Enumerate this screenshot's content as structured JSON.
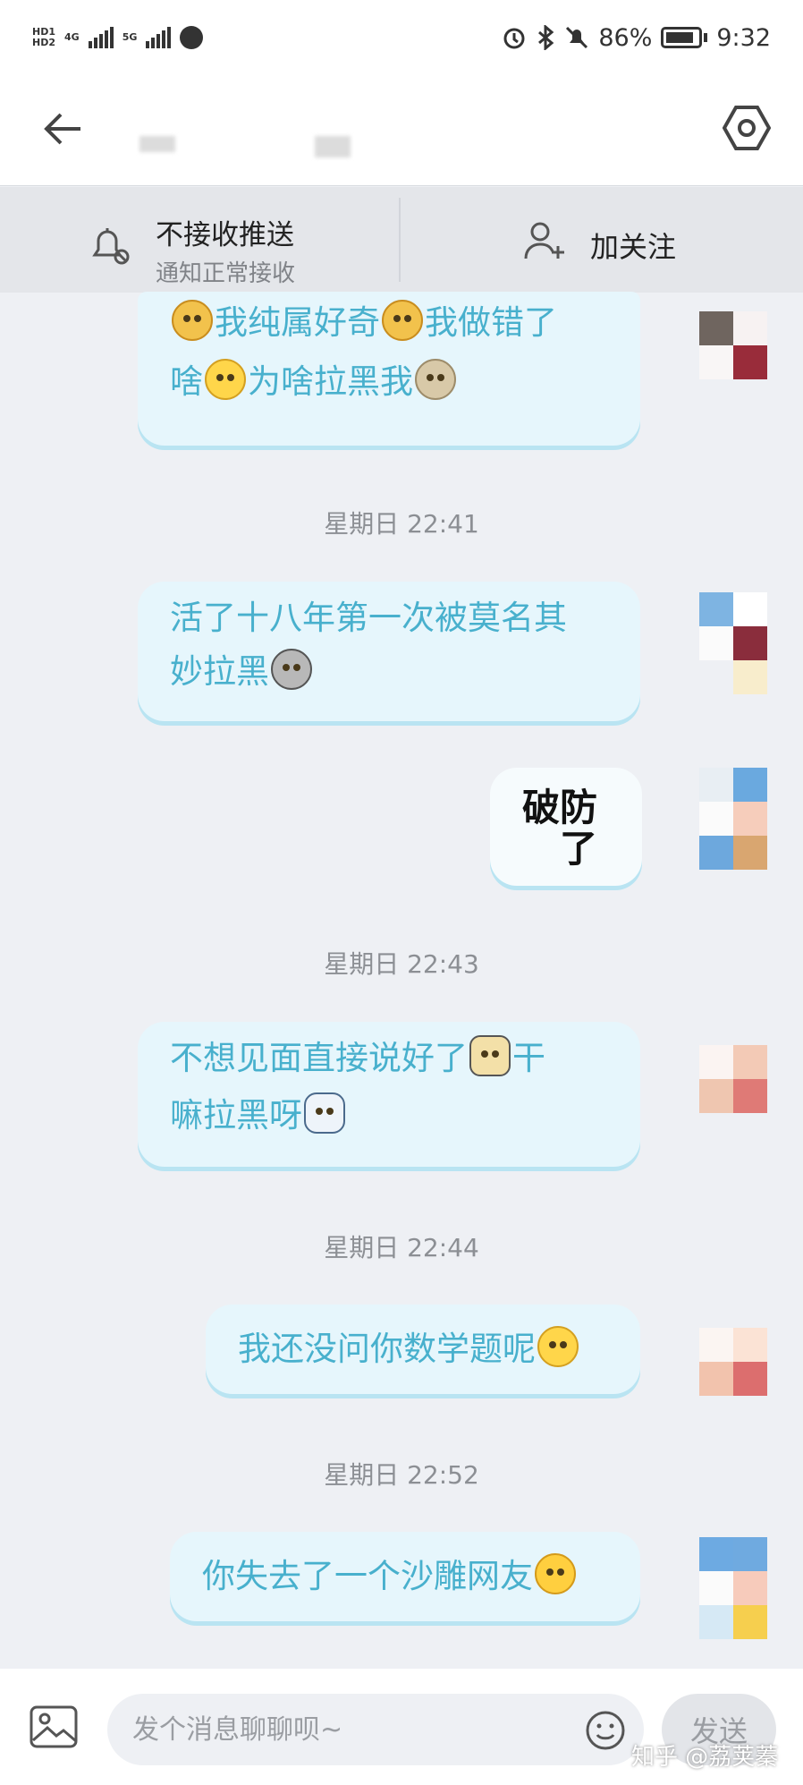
{
  "status_bar": {
    "hd1": "HD1",
    "hd2": "HD2",
    "network1": "4G",
    "network2": "5G",
    "battery": "86%",
    "time": "9:32"
  },
  "action_bar": {
    "push_title": "不接收推送",
    "push_subtitle": "通知正常接收",
    "follow_label": "加关注"
  },
  "messages": [
    {
      "line1": "我纯属好奇",
      "line1b": "我做错了",
      "line2a": "啥",
      "line2b": "为啥拉黑我"
    },
    {
      "time": "星期日 22:41",
      "line1": "活了十八年第一次被莫名其",
      "line2": "妙拉黑"
    },
    {
      "sticker_line1": "破防",
      "sticker_line2": "了"
    },
    {
      "time": "星期日 22:43",
      "line1a": "不想见面直接说好了",
      "line1b": "干",
      "line2": "嘛拉黑呀"
    },
    {
      "time": "星期日 22:44",
      "line1": "我还没问你数学题呢"
    },
    {
      "time": "星期日 22:52",
      "line1": "你失去了一个沙雕网友"
    }
  ],
  "input": {
    "placeholder": "发个消息聊聊呗~",
    "send_label": "发送"
  },
  "watermark": "知乎 @荔荚蓁",
  "colors": {
    "bubble_bg": "#e6f6fc",
    "bubble_text": "#48b0cd",
    "background": "#eef0f4"
  },
  "icons": [
    "back-arrow-icon",
    "settings-hexagon-icon",
    "bell-muted-icon",
    "add-user-icon",
    "image-icon",
    "emoji-icon"
  ]
}
